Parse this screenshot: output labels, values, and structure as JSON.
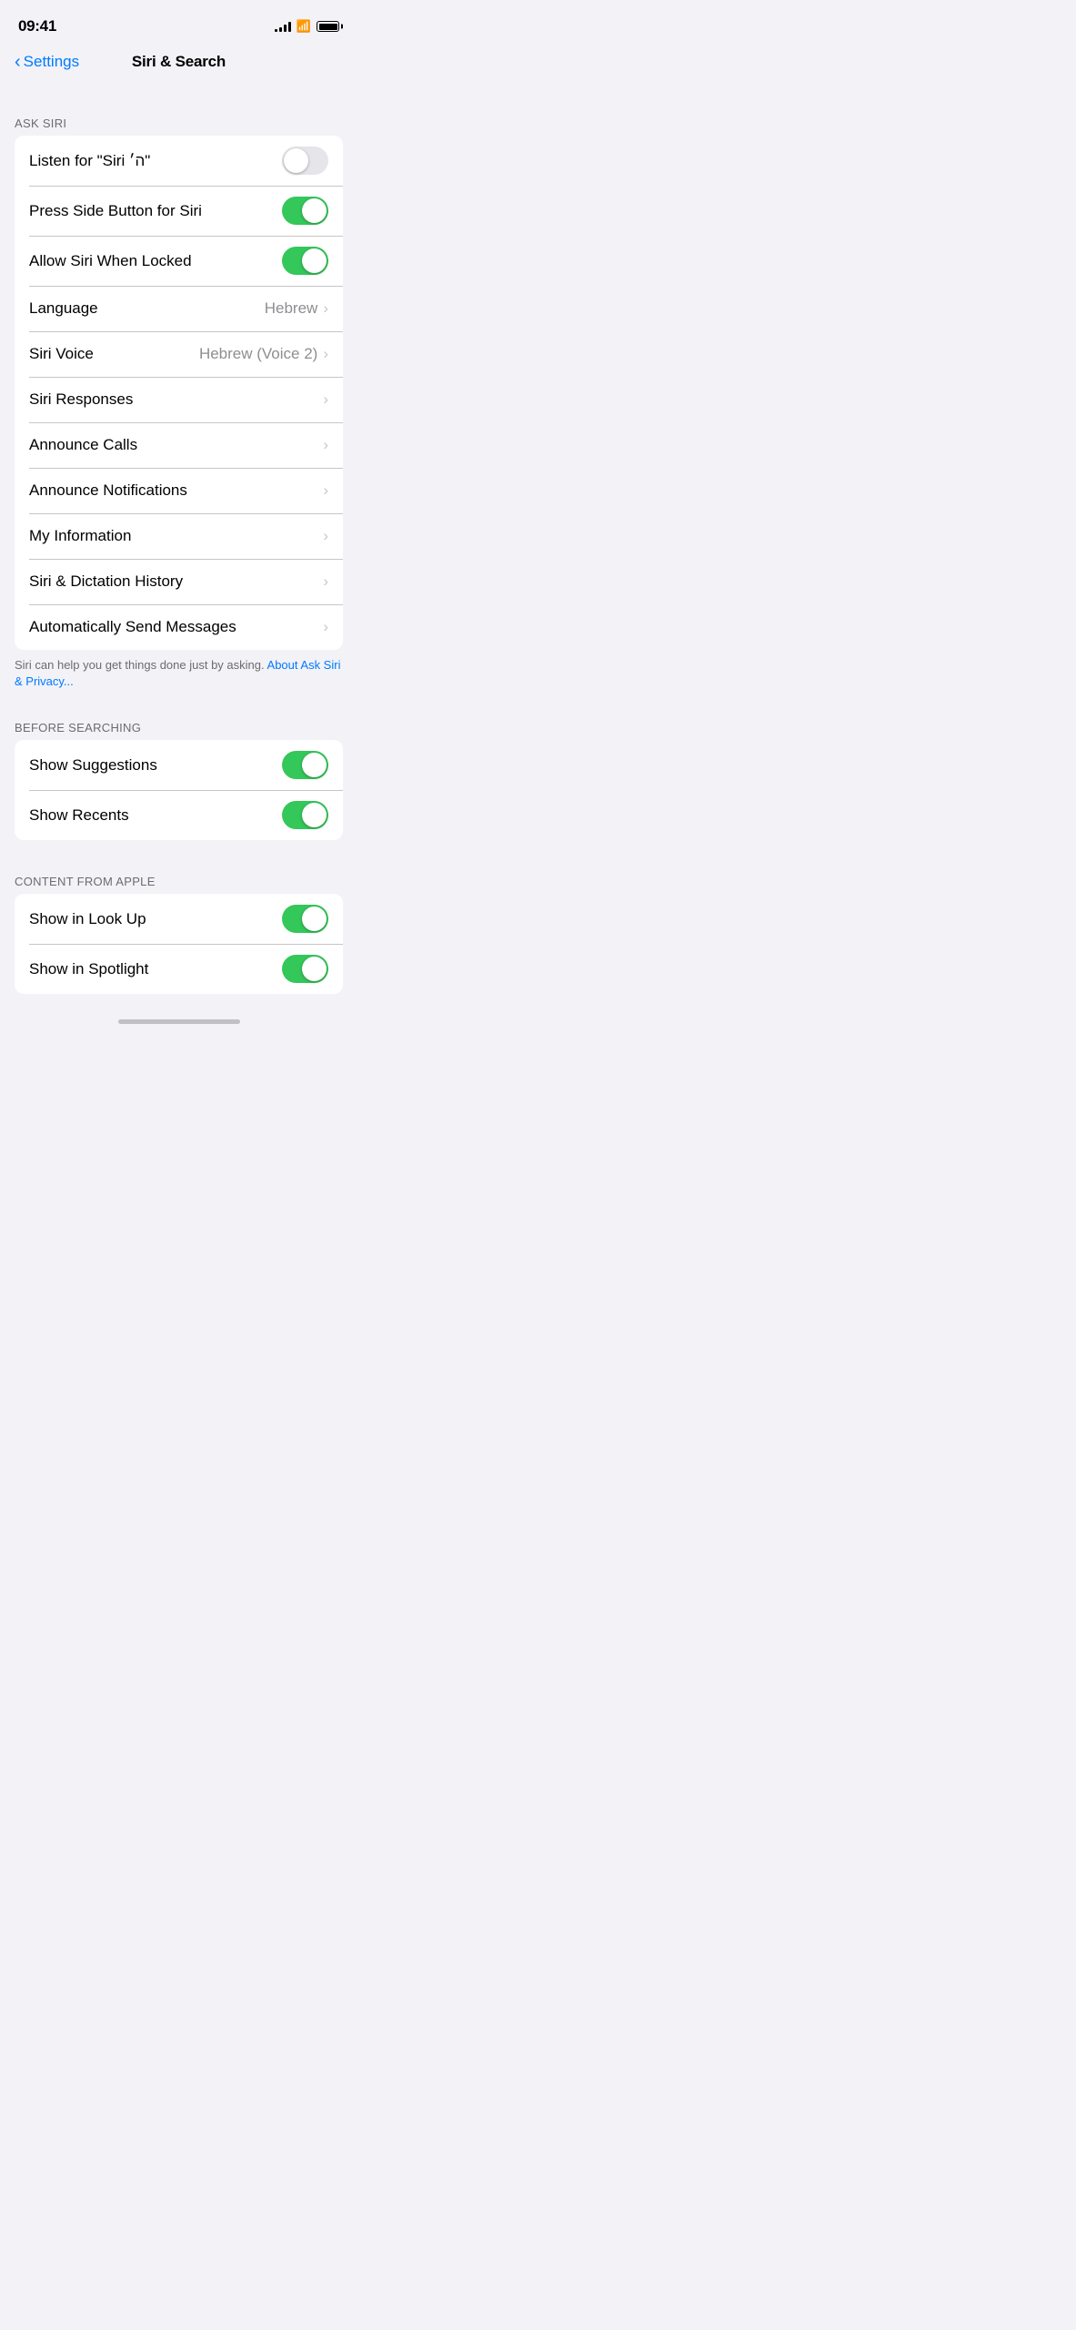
{
  "statusBar": {
    "time": "09:41",
    "battery": "full"
  },
  "navBar": {
    "backLabel": "Settings",
    "title": "Siri & Search"
  },
  "sections": [
    {
      "id": "ask-siri",
      "header": "ASK SIRI",
      "rows": [
        {
          "id": "listen-siri",
          "label": "Listen for \"Siri ה׳\"",
          "type": "toggle",
          "toggleState": "off"
        },
        {
          "id": "press-side-button",
          "label": "Press Side Button for Siri",
          "type": "toggle",
          "toggleState": "on"
        },
        {
          "id": "allow-siri-locked",
          "label": "Allow Siri When Locked",
          "type": "toggle",
          "toggleState": "on"
        },
        {
          "id": "language",
          "label": "Language",
          "type": "value-chevron",
          "value": "Hebrew"
        },
        {
          "id": "siri-voice",
          "label": "Siri Voice",
          "type": "value-chevron",
          "value": "Hebrew (Voice 2)"
        },
        {
          "id": "siri-responses",
          "label": "Siri Responses",
          "type": "chevron",
          "value": ""
        },
        {
          "id": "announce-calls",
          "label": "Announce Calls",
          "type": "chevron",
          "value": ""
        },
        {
          "id": "announce-notifications",
          "label": "Announce Notifications",
          "type": "chevron",
          "value": ""
        },
        {
          "id": "my-information",
          "label": "My Information",
          "type": "chevron",
          "value": ""
        },
        {
          "id": "siri-dictation-history",
          "label": "Siri & Dictation History",
          "type": "chevron",
          "value": ""
        },
        {
          "id": "auto-send-messages",
          "label": "Automatically Send Messages",
          "type": "chevron",
          "value": ""
        }
      ],
      "footer": "Siri can help you get things done just by asking.",
      "footerLink": "About Ask Siri & Privacy..."
    },
    {
      "id": "before-searching",
      "header": "BEFORE SEARCHING",
      "rows": [
        {
          "id": "show-suggestions",
          "label": "Show Suggestions",
          "type": "toggle",
          "toggleState": "on"
        },
        {
          "id": "show-recents",
          "label": "Show Recents",
          "type": "toggle",
          "toggleState": "on"
        }
      ],
      "footer": null
    },
    {
      "id": "content-from-apple",
      "header": "CONTENT FROM APPLE",
      "rows": [
        {
          "id": "show-in-look-up",
          "label": "Show in Look Up",
          "type": "toggle",
          "toggleState": "on"
        },
        {
          "id": "show-in-spotlight",
          "label": "Show in Spotlight",
          "type": "toggle",
          "toggleState": "on"
        }
      ],
      "footer": null
    }
  ]
}
